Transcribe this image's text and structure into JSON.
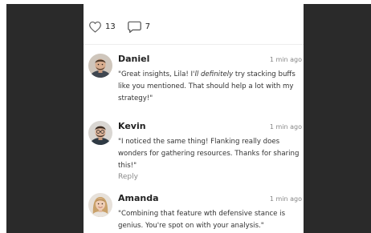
{
  "stats": {
    "likes": "13",
    "comments": "7"
  },
  "comments": [
    {
      "author": "Daniel",
      "time": "1 min ago",
      "text_before": "\"Great insights, Lila! I'",
      "text_em": "ll definitely",
      "text_after": " try stacking buffs like you mentioned. That should help a lot with my strategy!\""
    },
    {
      "author": "Kevin",
      "time": "1 min ago",
      "text": "\"I noticed the same thing! Flanking really does wonders for gathering resources. Thanks for sharing this!\"",
      "reply_label": "Reply"
    },
    {
      "author": "Amanda",
      "time": "1 min ago",
      "text": "\"Combining that feature wth defensive stance is genius. You're spot on with your analysis.\""
    }
  ],
  "colors": {
    "background": "#2a2a2a",
    "card": "#ffffff",
    "text": "#333333",
    "muted": "#888888"
  }
}
